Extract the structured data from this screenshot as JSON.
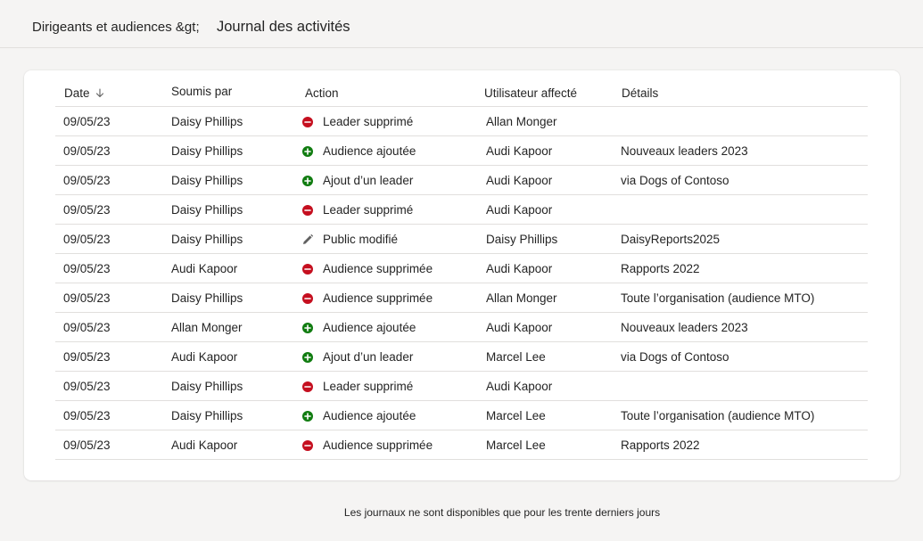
{
  "header": {
    "breadcrumb_parent": "Dirigeants et audiences &gt;",
    "title": "Journal des activités"
  },
  "table": {
    "columns": {
      "date": "Date",
      "submitted_by": "Soumis par",
      "action": "Action",
      "affected_user": "Utilisateur affecté",
      "details": "Détails"
    },
    "sort": {
      "column": "date",
      "direction": "descending",
      "icon": "arrow-down-icon"
    },
    "rows": [
      {
        "date": "09/05/23",
        "submitted_by": "Daisy Phillips",
        "action": "Leader supprimé",
        "action_type": "remove",
        "affected_user": "Allan Monger",
        "details": ""
      },
      {
        "date": "09/05/23",
        "submitted_by": "Daisy Phillips",
        "action": "Audience ajoutée",
        "action_type": "add",
        "affected_user": "Audi Kapoor",
        "details": "Nouveaux leaders 2023"
      },
      {
        "date": "09/05/23",
        "submitted_by": "Daisy Phillips",
        "action": "Ajout d’un leader",
        "action_type": "add",
        "affected_user": "Audi Kapoor",
        "details": "via Dogs of Contoso"
      },
      {
        "date": "09/05/23",
        "submitted_by": "Daisy Phillips",
        "action": "Leader supprimé",
        "action_type": "remove",
        "affected_user": "Audi Kapoor",
        "details": ""
      },
      {
        "date": "09/05/23",
        "submitted_by": "Daisy Phillips",
        "action": "Public modifié",
        "action_type": "edit",
        "affected_user": "Daisy Phillips",
        "details": "DaisyReports2025"
      },
      {
        "date": "09/05/23",
        "submitted_by": "Audi Kapoor",
        "action": "Audience supprimée",
        "action_type": "remove",
        "affected_user": "Audi Kapoor",
        "details": "Rapports 2022"
      },
      {
        "date": "09/05/23",
        "submitted_by": "Daisy Phillips",
        "action": "Audience supprimée",
        "action_type": "remove",
        "affected_user": "Allan Monger",
        "details": "Toute l’organisation (audience MTO)"
      },
      {
        "date": "09/05/23",
        "submitted_by": "Allan Monger",
        "action": "Audience ajoutée",
        "action_type": "add",
        "affected_user": "Audi Kapoor",
        "details": "Nouveaux leaders 2023"
      },
      {
        "date": "09/05/23",
        "submitted_by": "Audi Kapoor",
        "action": "Ajout d’un leader",
        "action_type": "add",
        "affected_user": "Marcel  Lee",
        "details": "via Dogs of Contoso"
      },
      {
        "date": "09/05/23",
        "submitted_by": "Daisy Phillips",
        "action": "Leader supprimé",
        "action_type": "remove",
        "affected_user": "Audi Kapoor",
        "details": ""
      },
      {
        "date": "09/05/23",
        "submitted_by": "Daisy Phillips",
        "action": "Audience ajoutée",
        "action_type": "add",
        "affected_user": "Marcel  Lee",
        "details": "Toute l’organisation (audience MTO)"
      },
      {
        "date": "09/05/23",
        "submitted_by": "Audi Kapoor",
        "action": "Audience supprimée",
        "action_type": "remove",
        "affected_user": "Marcel  Lee",
        "details": "Rapports 2022"
      }
    ]
  },
  "footer": {
    "note": "Les journaux ne sont disponibles que pour les trente derniers jours"
  },
  "icons": {
    "add": "plus-circle-icon",
    "remove": "minus-circle-icon",
    "edit": "pencil-icon"
  },
  "colors": {
    "add": "#107c10",
    "remove": "#c50f1f",
    "edit": "#616161",
    "background": "#f5f4f3",
    "card": "#ffffff",
    "divider": "#e1dfdd"
  }
}
